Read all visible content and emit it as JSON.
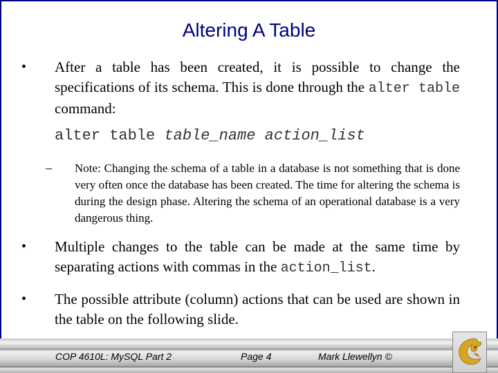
{
  "slide": {
    "title": "Altering A Table",
    "bullets": [
      {
        "symbol": "•",
        "text_before": "After a table has been created, it is possible to change the specifications of its schema.  This is done through the ",
        "code": "alter table",
        "text_after": " command:"
      },
      {
        "symbol": "•",
        "text_before": "Multiple changes to the table can be made at the same time by separating actions with commas in the ",
        "code": "action_list",
        "text_after": "."
      },
      {
        "symbol": "•",
        "text": "The possible attribute (column) actions that can be used are shown in the table on the following slide."
      }
    ],
    "syntax": {
      "keyword": "alter table ",
      "param1": "table_name",
      "space": " ",
      "param2": "action_list"
    },
    "note": {
      "symbol": "–",
      "text": "Note:  Changing the schema of a table in a database is not something that is done very often once the database has been created.  The time for altering the schema is during the design phase.   Altering the schema of an operational database is a very dangerous thing."
    }
  },
  "footer": {
    "course": "COP 4610L: MySQL Part 2",
    "page": "Page 4",
    "author": "Mark Llewellyn ©",
    "logo": "ucf-pegasus-logo-icon"
  },
  "colors": {
    "title": "#000080",
    "border": "#000080",
    "logo_gold": "#d9a520"
  }
}
